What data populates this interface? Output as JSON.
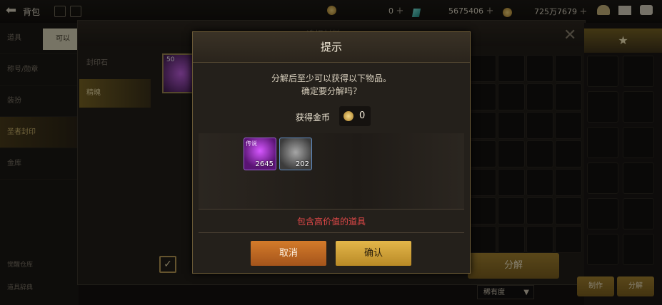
{
  "topbar": {
    "title": "背包",
    "res1_value": "0",
    "res2_value": "5675406",
    "res3_value": "725万7679"
  },
  "leftnav": {
    "items": [
      "道具",
      "称号/勋章",
      "装扮",
      "圣者封印",
      "金库"
    ],
    "active_index": 3,
    "tooltip": "可以",
    "bottom_links": [
      "觉醒仓库",
      "道具辞典"
    ]
  },
  "under_dialog": {
    "title": "选择材料",
    "subtabs": [
      "封印石",
      "精魄"
    ],
    "active_subtab": 1,
    "decompose_label": "分解",
    "sort_label": "稀有度",
    "card_badge": "50"
  },
  "right_panel": {
    "craft_label": "制作",
    "decompose_label": "分解"
  },
  "modal": {
    "title": "提示",
    "message_line1": "分解后至少可以获得以下物品。",
    "message_line2": "确定要分解吗？",
    "gold_label": "获得金币",
    "gold_value": "0",
    "items": [
      {
        "name": "purple-essence",
        "tag": "传说",
        "count": "2645"
      },
      {
        "name": "gray-crystal",
        "count": "202"
      }
    ],
    "warning": "包含高价值的道具",
    "cancel_label": "取消",
    "confirm_label": "确认"
  },
  "colors": {
    "accent_gold": "#b98a26",
    "cancel_orange": "#d47b2a",
    "warning_red": "#e04848"
  }
}
